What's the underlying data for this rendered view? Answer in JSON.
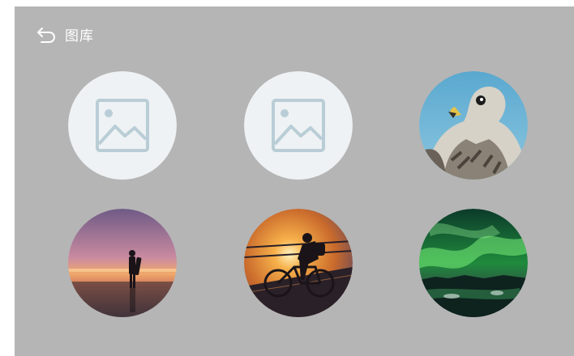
{
  "header": {
    "title": "图库",
    "back_icon": "back-arrow-icon"
  },
  "gallery": {
    "items": [
      {
        "kind": "placeholder",
        "icon": "image-placeholder-icon"
      },
      {
        "kind": "placeholder",
        "icon": "image-placeholder-icon"
      },
      {
        "kind": "photo",
        "subject": "falcon"
      },
      {
        "kind": "photo",
        "subject": "beach-sunset-silhouette"
      },
      {
        "kind": "photo",
        "subject": "cyclist-sunset-bridge"
      },
      {
        "kind": "photo",
        "subject": "aurora-borealis"
      }
    ]
  },
  "colors": {
    "background": "#b5b5b5",
    "placeholder_bg": "#eef2f4",
    "placeholder_icon": "#b9cdd6",
    "text": "#ffffff"
  }
}
